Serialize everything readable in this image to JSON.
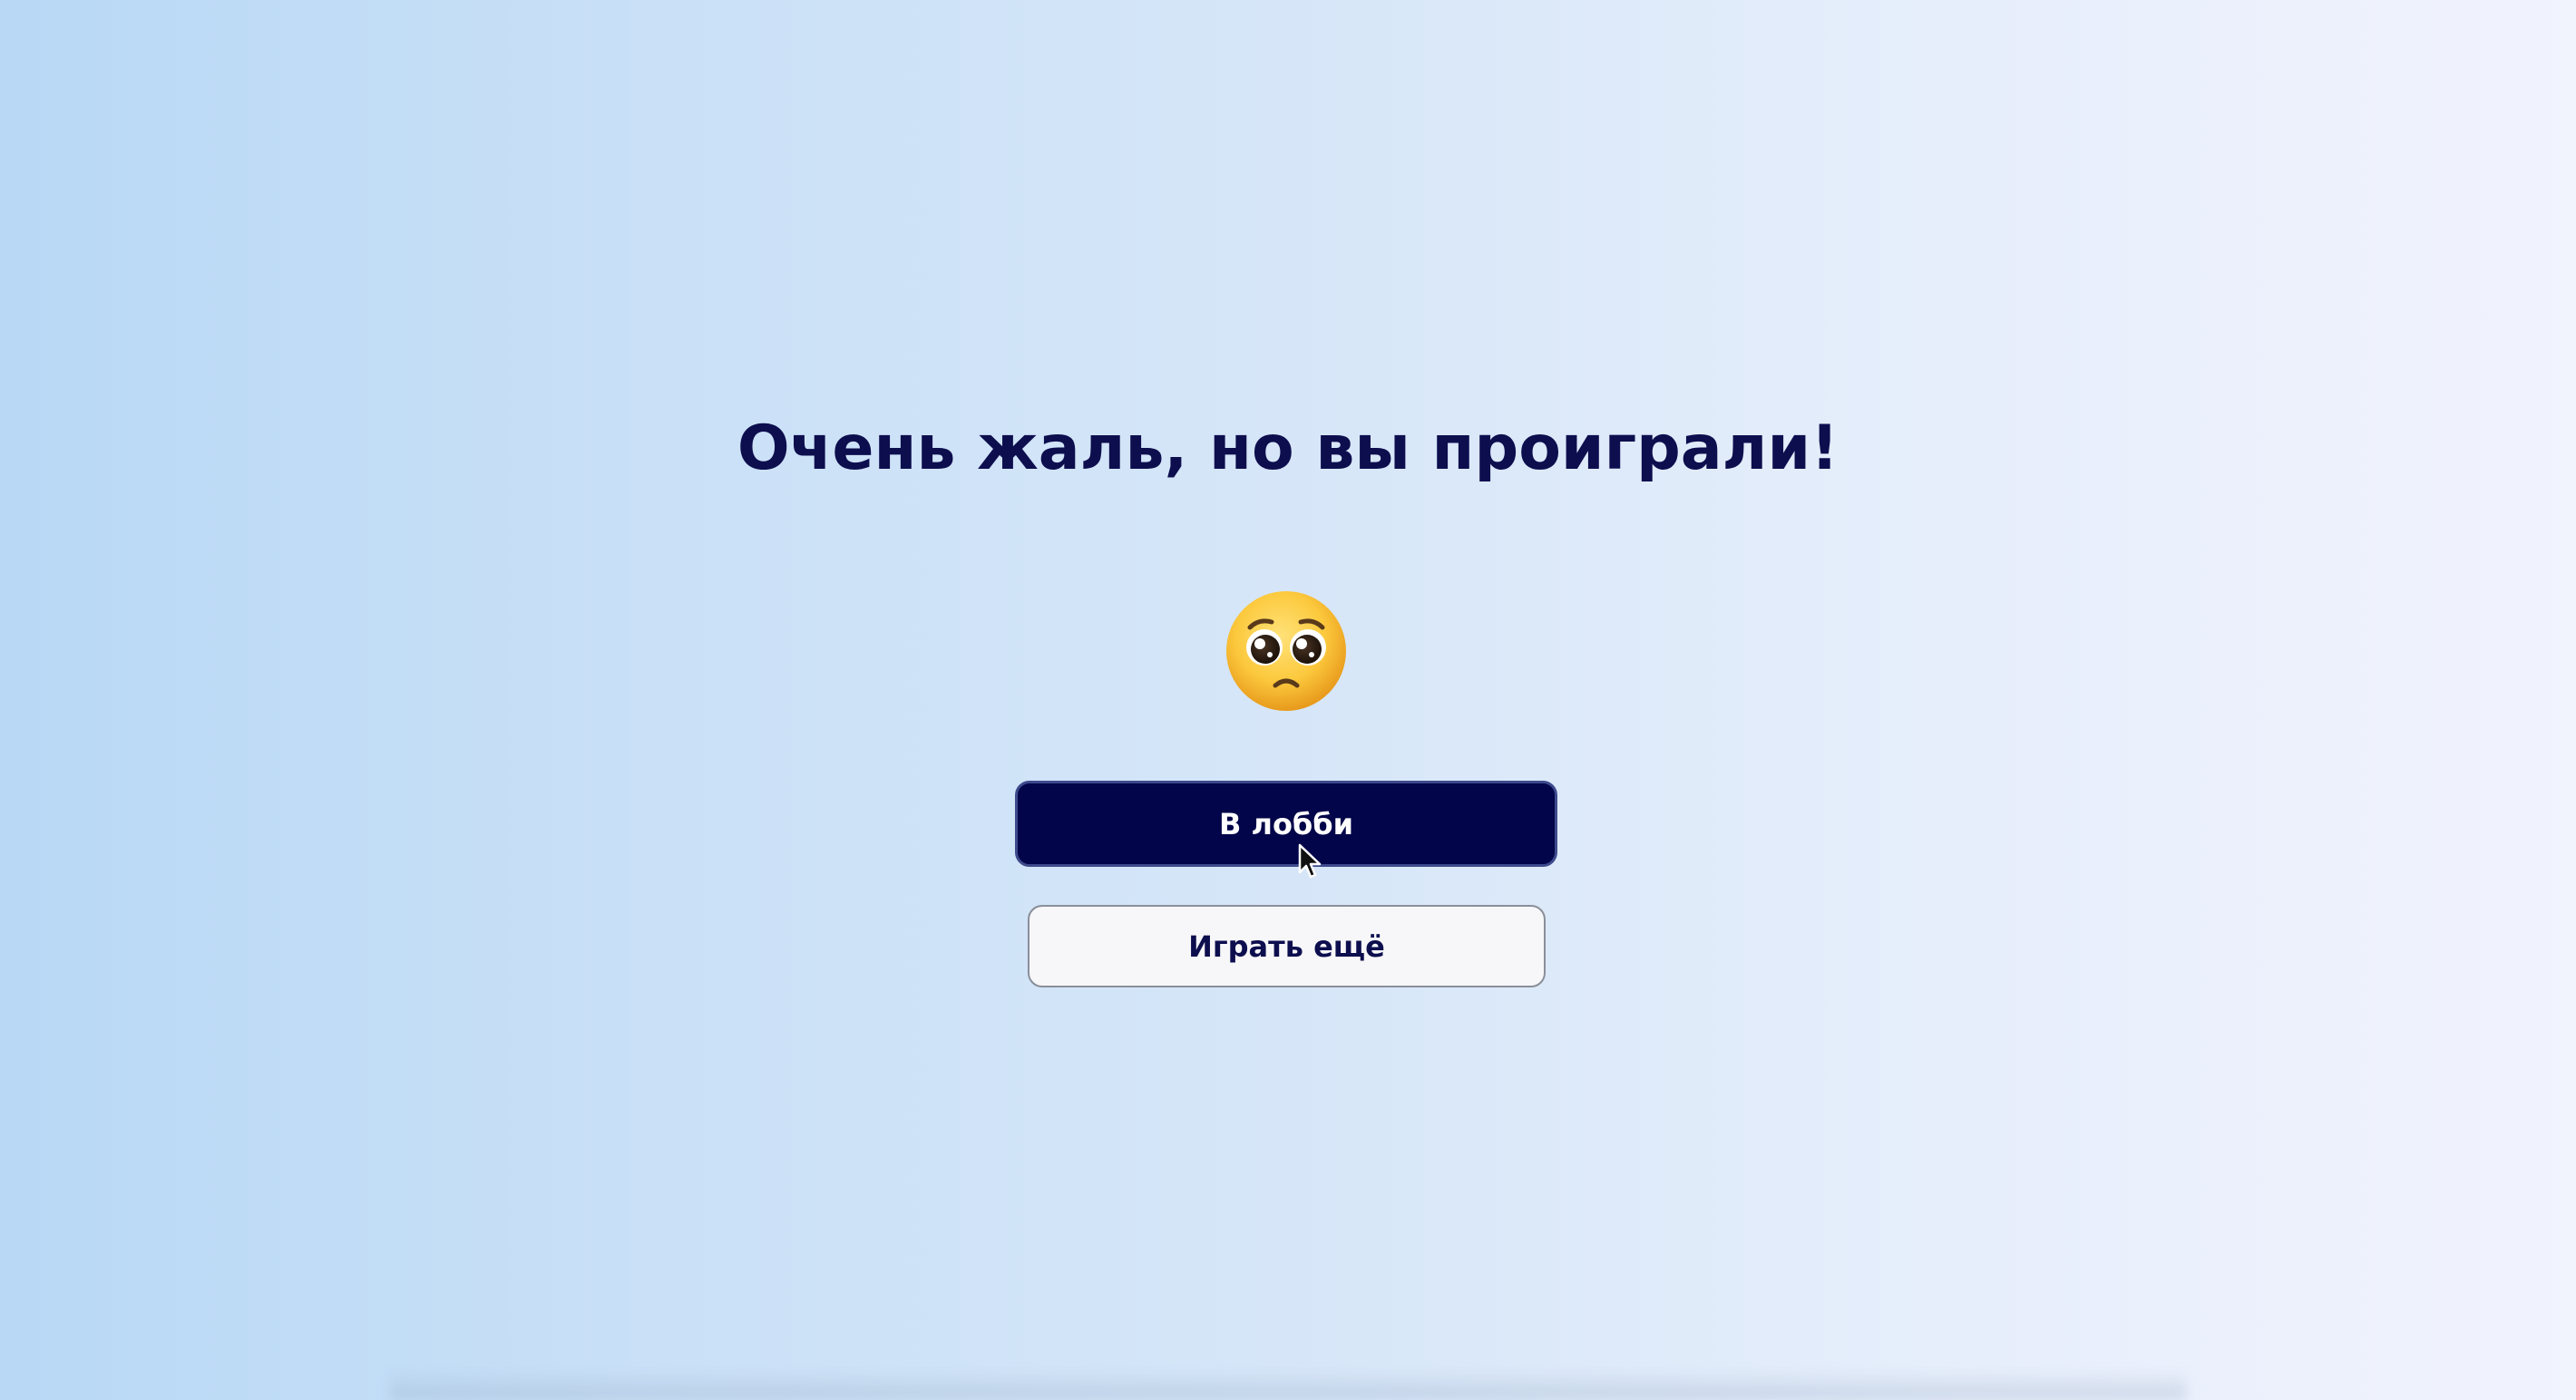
{
  "result": {
    "title": "Очень жаль, но вы проиграли!",
    "emoji_icon": "pleading-face-icon"
  },
  "actions": {
    "lobby_label": "В лобби",
    "play_again_label": "Играть ещё"
  },
  "colors": {
    "title": "#0d0e4e",
    "primary_button": "#020549",
    "secondary_button": "#f7f7f9"
  }
}
